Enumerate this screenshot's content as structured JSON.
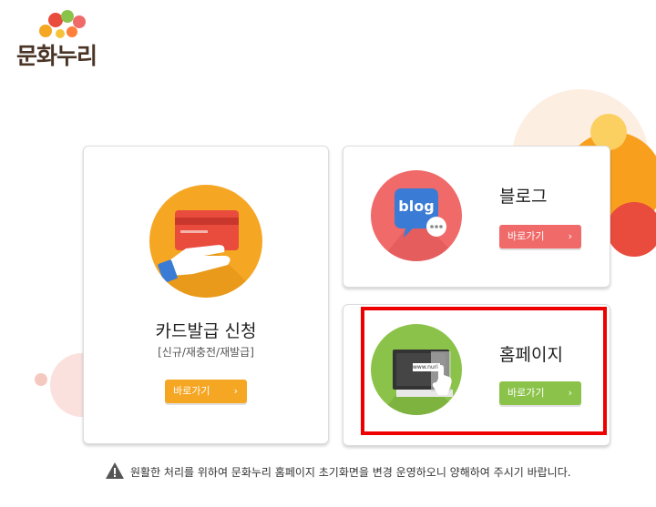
{
  "logo": {
    "text": "문화누리"
  },
  "cards": {
    "apply": {
      "title": "카드발급 신청",
      "subtitle": "[신규/재충전/재발급]",
      "button_label": "바로가기",
      "button_arrow": "›",
      "icon": "card-hand-icon",
      "color": "#f5a623"
    },
    "blog": {
      "title": "블로그",
      "button_label": "바로가기",
      "button_arrow": "›",
      "icon": "blog-speech-icon",
      "icon_text": "blog",
      "color": "#f06a6a"
    },
    "homepage": {
      "title": "홈페이지",
      "button_label": "바로가기",
      "button_arrow": "›",
      "icon": "monitor-pointer-icon",
      "icon_text": "www.nuri",
      "color": "#8bc34a"
    }
  },
  "notice": {
    "text": "원활한 처리를 위하여 문화누리 홈페이지 초기화면을 변경 운영하오니 양해하여 주시기 바랍니다.",
    "icon": "warning-icon"
  },
  "colors": {
    "highlight": "#ee0000",
    "logo_brown": "#4a3426"
  }
}
